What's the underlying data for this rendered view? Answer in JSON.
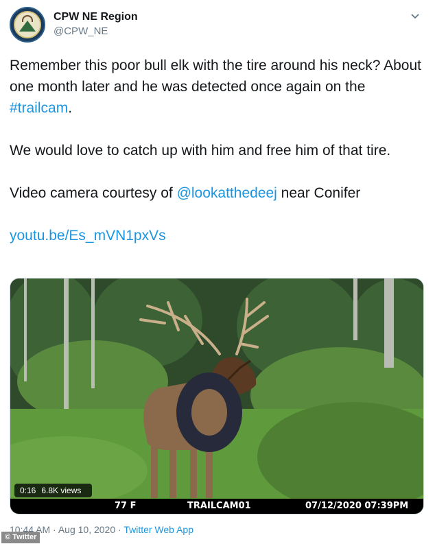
{
  "tweet": {
    "author_name": "CPW NE Region",
    "handle": "@CPW_NE",
    "text_1_a": "Remember this poor bull elk with the tire around his neck? About one month later and he was detected once again on the ",
    "text_1_hashtag": "#trailcam",
    "text_1_b": ".",
    "text_2": "We would love to catch up with him and free him of that tire.",
    "text_3_a": "Video camera courtesy of ",
    "text_3_mention": "@lookatthedeej",
    "text_3_b": " near Conifer",
    "link": "youtu.be/Es_mVN1pxVs",
    "timestamp": "10:44 AM · Aug 10, 2020 · ",
    "source_app": "Twitter Web App"
  },
  "video": {
    "duration": "0:16",
    "views": "6.8K views",
    "temperature": "77 F",
    "camera_name": "TRAILCAM01",
    "date_time": "07/12/2020  07:39PM"
  },
  "credit": "© Twitter",
  "colors": {
    "link": "#1b95e0",
    "text": "#14171a",
    "muted": "#657786"
  }
}
